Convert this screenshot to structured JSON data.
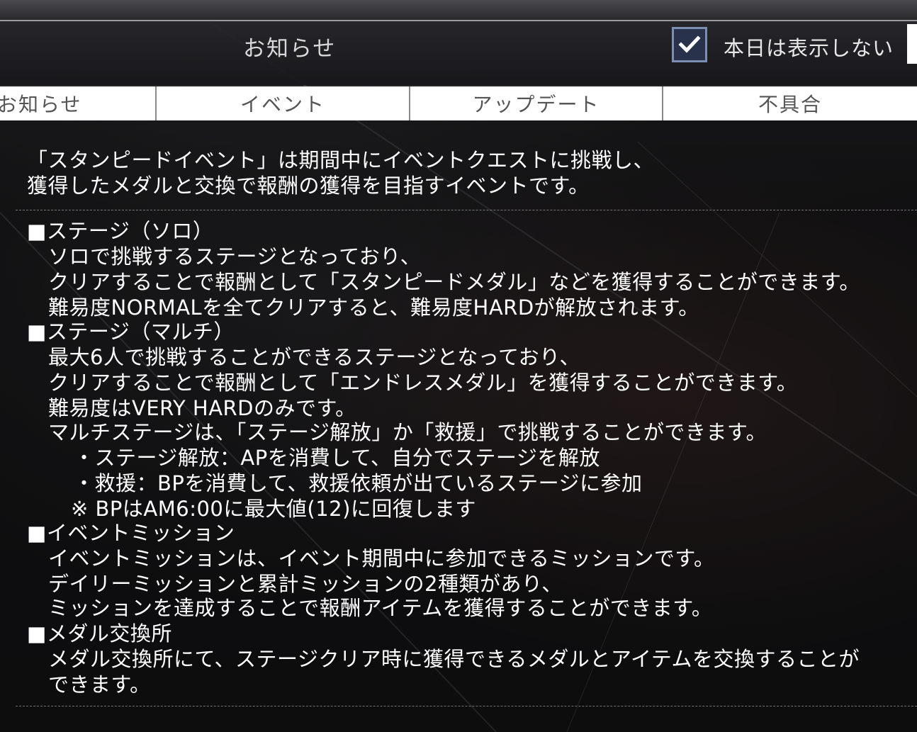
{
  "header": {
    "title": "お知らせ",
    "hide_today_checked": true,
    "hide_today_label": "本日は表示しない"
  },
  "tabs": [
    {
      "label": "お知らせ"
    },
    {
      "label": "イベント"
    },
    {
      "label": "アップデート"
    },
    {
      "label": "不具合"
    }
  ],
  "notice": {
    "intro": [
      "「スタンピードイベント」は期間中にイベントクエストに挑戦し、",
      "獲得したメダルと交換で報酬の獲得を目指すイベントです。"
    ],
    "body": [
      "■ステージ（ソロ）",
      "ソロで挑戦するステージとなっており、",
      "クリアすることで報酬として「スタンピードメダル」などを獲得することができます。",
      "難易度NORMALを全てクリアすると、難易度HARDが解放されます。",
      "■ステージ（マルチ）",
      "最大6人で挑戦することができるステージとなっており、",
      "クリアすることで報酬として「エンドレスメダル」を獲得することができます。",
      "難易度はVERY HARDのみです。",
      "マルチステージは、「ステージ解放」か「救援」で挑戦することができます。",
      "・ステージ解放：APを消費して、自分でステージを解放",
      "・救援：BPを消費して、救援依頼が出ているステージに参加",
      "※ BPはAM6:00に最大値(12)に回復します",
      "■イベントミッション",
      "イベントミッションは、イベント期間中に参加できるミッションです。",
      "デイリーミッションと累計ミッションの2種類があり、",
      "ミッションを達成することで報酬アイテムを獲得することができます。",
      "■メダル交換所",
      "メダル交換所にて、ステージクリア時に獲得できるメダルとアイテムを交換することが",
      "できます。"
    ]
  },
  "colors": {
    "tab_bg": "#ffffff",
    "tab_text": "#555555",
    "checkbox_border": "#7d8fb0",
    "text": "#ffffff"
  },
  "icons": {
    "checkbox": "checkmark-icon"
  }
}
